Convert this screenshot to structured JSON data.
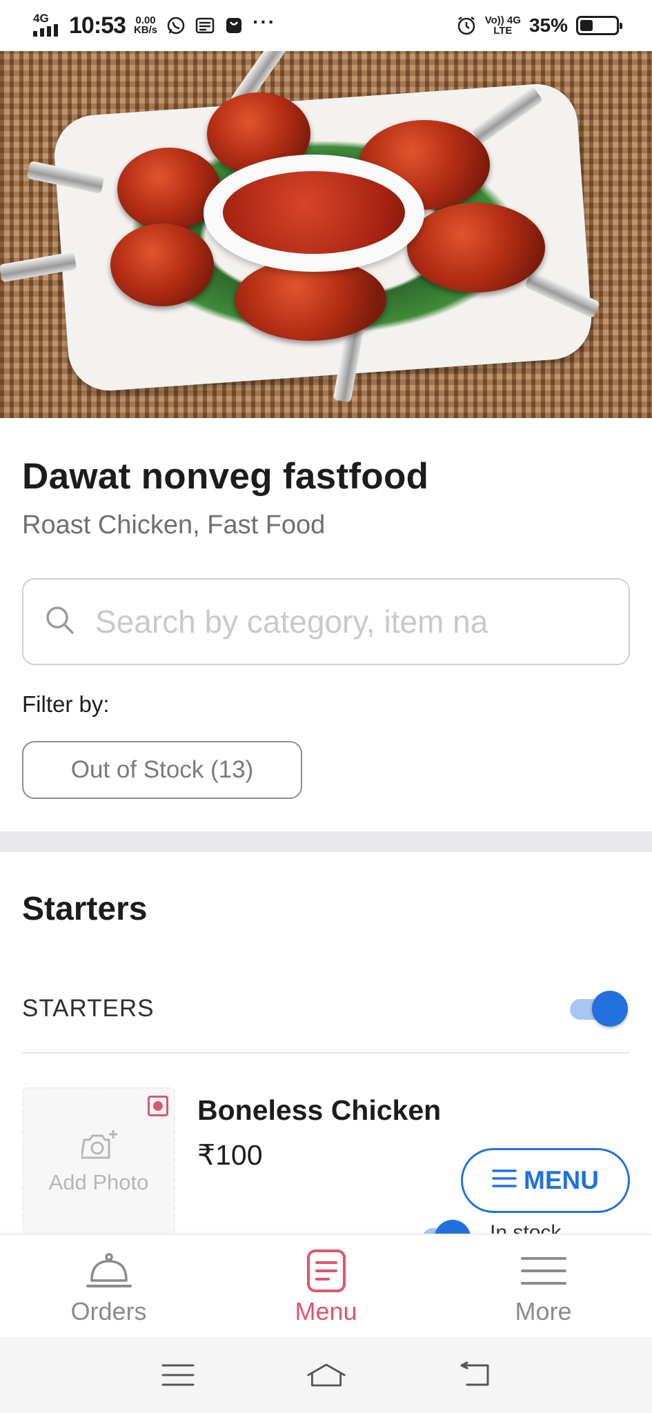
{
  "status_bar": {
    "network": "4G",
    "time": "10:53",
    "speed_value": "0.00",
    "speed_unit": "KB/s",
    "overflow": "···",
    "volte_line1": "Vo)) 4G",
    "volte_line2": "LTE",
    "battery_percent": "35%",
    "battery_level": 0.35
  },
  "restaurant": {
    "name": "Dawat nonveg fastfood",
    "cuisines": "Roast Chicken, Fast Food"
  },
  "search": {
    "placeholder": "Search by category, item na",
    "value": ""
  },
  "filter": {
    "label": "Filter by:",
    "chips": [
      {
        "label": "Out of Stock (13)"
      }
    ]
  },
  "menu": {
    "section_title": "Starters",
    "subcategory": {
      "name": "STARTERS",
      "enabled": true
    },
    "items": [
      {
        "name": "Boneless Chicken",
        "price": "₹100",
        "add_photo_label": "Add Photo",
        "in_stock_label": "In stock",
        "in_stock": true,
        "diet_mark_color": "#e0556a"
      }
    ]
  },
  "fab": {
    "label": "MENU"
  },
  "bottom_nav": {
    "items": [
      {
        "label": "Orders",
        "icon": "bell-icon",
        "active": false
      },
      {
        "label": "Menu",
        "icon": "menu-document-icon",
        "active": true
      },
      {
        "label": "More",
        "icon": "hamburger-icon",
        "active": false
      }
    ]
  },
  "colors": {
    "accent": "#2270de",
    "active_tab": "#e0556a",
    "muted_text": "#6f6f6f"
  }
}
